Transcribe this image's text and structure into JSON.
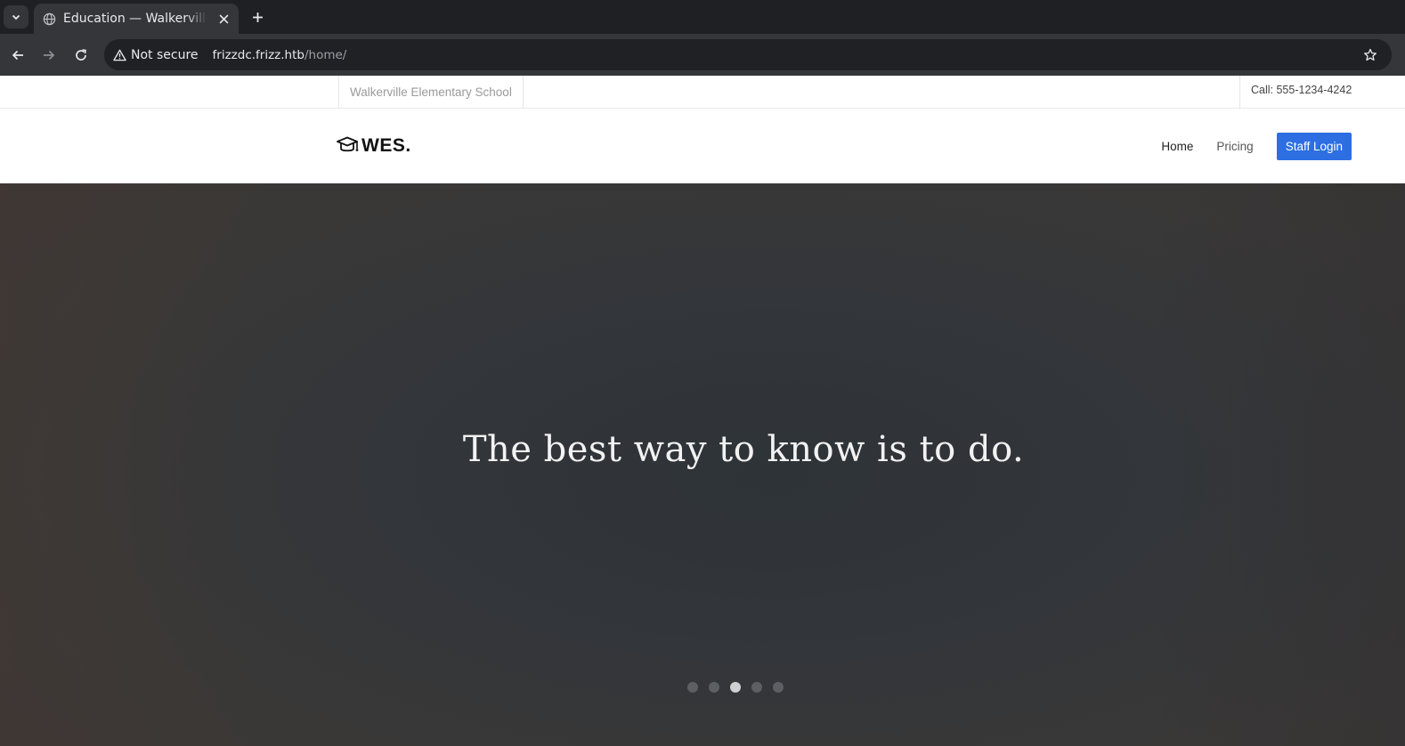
{
  "browser": {
    "tab_title": "Education — Walkerville Elementary School",
    "security_label": "Not secure",
    "url_host": "frizzdc.frizz.htb",
    "url_path": "/home/"
  },
  "topstrip": {
    "school_name": "Walkerville Elementary School",
    "phone": "Call: 555-1234-4242"
  },
  "navbar": {
    "logo_text": "WES.",
    "menu": [
      {
        "label": "Home",
        "active": true
      },
      {
        "label": "Pricing",
        "active": false
      }
    ],
    "staff_login": "Staff Login"
  },
  "hero": {
    "headline": "The best way to know is to do.",
    "slides_count": 5,
    "active_slide": 3
  },
  "colors": {
    "accent": "#2d6ee3",
    "chrome_dark": "#1f2023",
    "chrome_toolbar": "#35363a"
  }
}
